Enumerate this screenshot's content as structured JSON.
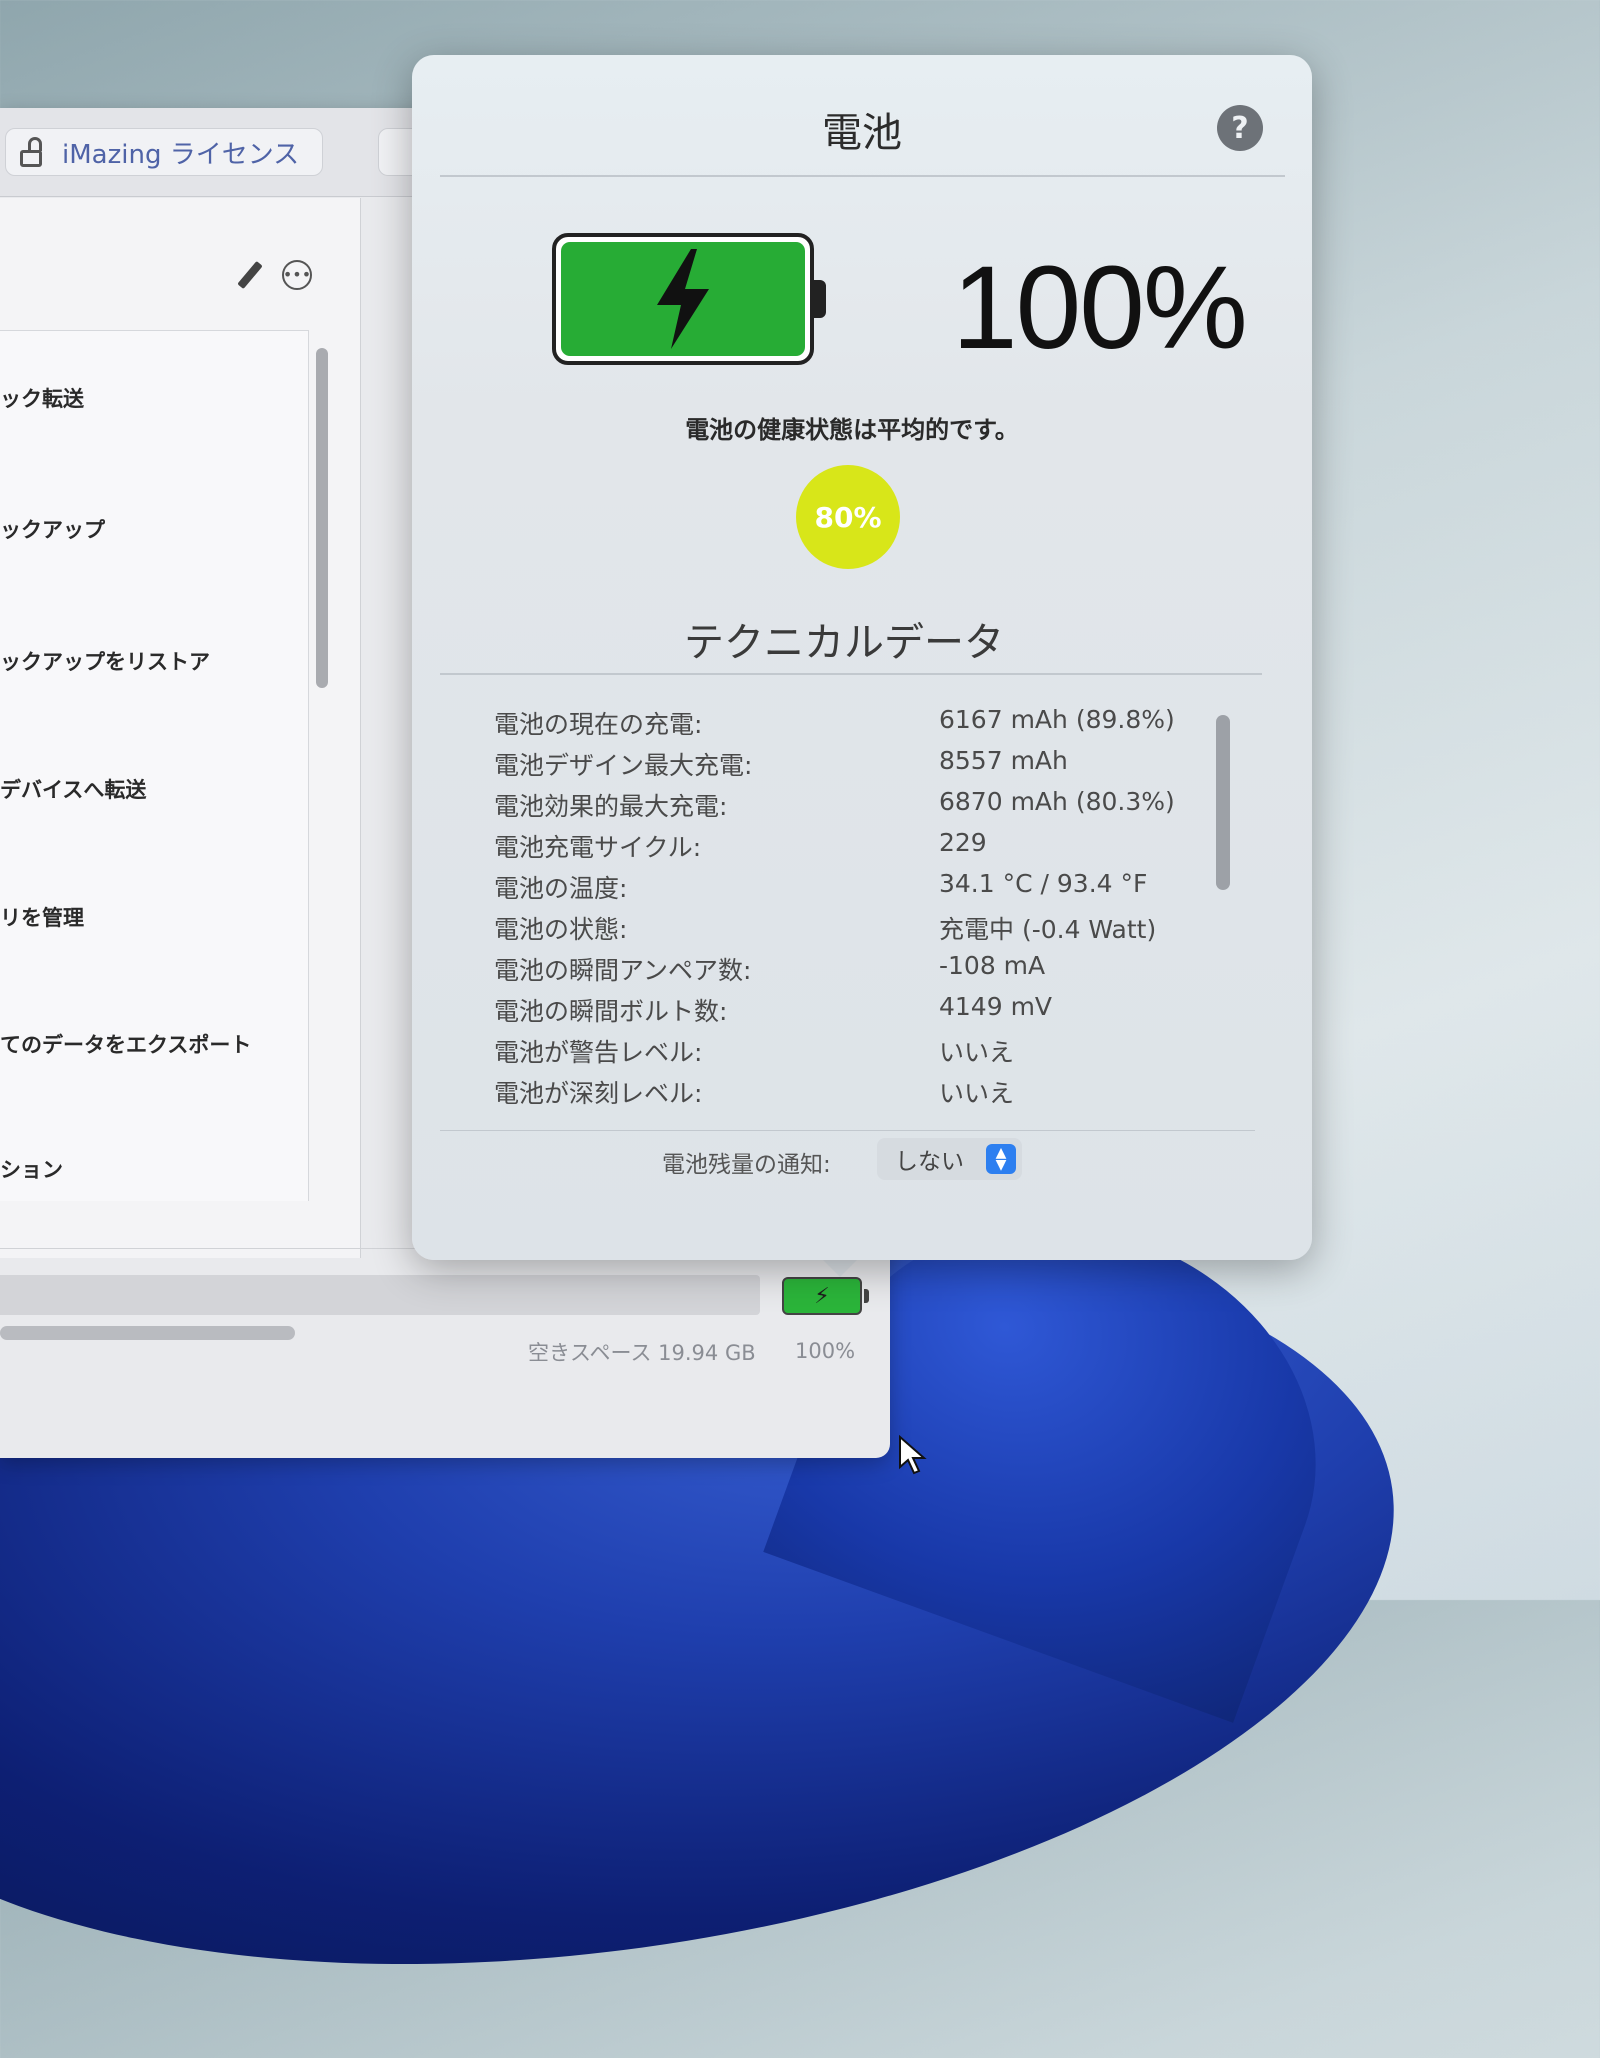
{
  "app": {
    "license_button_label": "iMazing ライセンス",
    "sidebar_items": [
      "ック転送",
      "ックアップ",
      "ックアップをリストア",
      "デバイスへ転送",
      "リを管理",
      "てのデータをエクスポート",
      "ション"
    ],
    "free_space": "空きスペース 19.94 GB",
    "battery_percent": "100%"
  },
  "popover": {
    "title": "電池",
    "help_label": "?",
    "charge_percent": "100%",
    "health_text": "電池の健康状態は平均的です。",
    "health_badge": "80%",
    "tech_title": "テクニカルデータ",
    "tech_rows": [
      {
        "label": "電池の現在の充電:",
        "value": "6167 mAh (89.8%)"
      },
      {
        "label": "電池デザイン最大充電:",
        "value": "8557 mAh"
      },
      {
        "label": "電池効果的最大充電:",
        "value": "6870 mAh (80.3%)"
      },
      {
        "label": "電池充電サイクル:",
        "value": "229"
      },
      {
        "label": "電池の温度:",
        "value": "34.1 °C / 93.4 °F"
      },
      {
        "label": "電池の状態:",
        "value": "充電中 (-0.4 Watt)"
      },
      {
        "label": "電池の瞬間アンペア数:",
        "value": "-108 mA"
      },
      {
        "label": "電池の瞬間ボルト数:",
        "value": "4149 mV"
      },
      {
        "label": "電池が警告レベル:",
        "value": "いいえ"
      },
      {
        "label": "電池が深刻レベル:",
        "value": "いいえ"
      }
    ],
    "notify_label": "電池残量の通知:",
    "notify_value": "しない"
  },
  "colors": {
    "battery_green": "#27ac35",
    "health_badge": "#d8e619",
    "select_accent": "#2d7ff0",
    "license_text": "#4f63a7"
  },
  "icons": [
    "lock-icon",
    "pencil-icon",
    "more-icon",
    "help-icon",
    "lightning-icon",
    "chevron-updown-icon",
    "cursor-icon"
  ]
}
